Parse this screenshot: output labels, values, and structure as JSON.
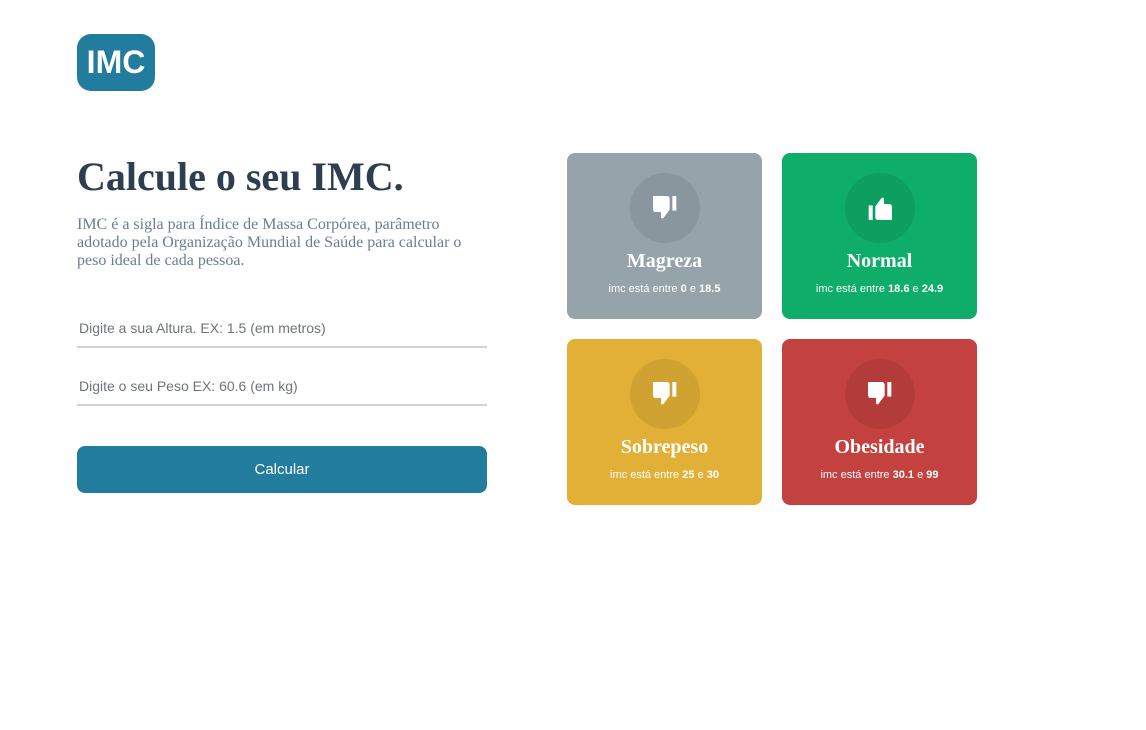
{
  "logo": {
    "text": "IMC",
    "color": "#227c9d"
  },
  "main": {
    "title": "Calcule o seu IMC.",
    "description": "IMC é a sigla para Índice de Massa Corpórea, parâmetro adotado pela Organização Mundial de Saúde para calcular o peso ideal de cada pessoa.",
    "height_placeholder": "Digite a sua Altura. EX: 1.5 (em metros)",
    "weight_placeholder": "Digite o seu Peso EX: 60.6 (em kg)",
    "calc_label": "Calcular"
  },
  "cards": [
    {
      "title": "Magreza",
      "prefix": "imc está entre",
      "min": "0",
      "sep": "e",
      "max": "18.5",
      "icon": "thumbs-down-icon",
      "color": "#96a3ab"
    },
    {
      "title": "Normal",
      "prefix": "imc está entre",
      "min": "18.6",
      "sep": "e",
      "max": "24.9",
      "icon": "thumbs-up-icon",
      "color": "#0ead69"
    },
    {
      "title": "Sobrepeso",
      "prefix": "imc está entre",
      "min": "25",
      "sep": "e",
      "max": "30",
      "icon": "thumbs-down-icon",
      "color": "#e2b036"
    },
    {
      "title": "Obesidade",
      "prefix": "imc está entre",
      "min": "30.1",
      "sep": "e",
      "max": "99",
      "icon": "thumbs-down-icon",
      "color": "#c3423f"
    }
  ]
}
